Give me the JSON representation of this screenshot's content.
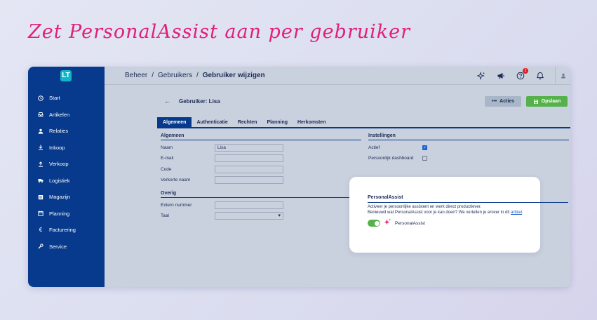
{
  "headline": "Zet PersonalAssist aan per gebruiker",
  "app": {
    "logo": "LT",
    "colors": {
      "sidebar": "#073a8c",
      "accent_green": "#55b24a",
      "headline": "#e0207a"
    }
  },
  "sidebar": {
    "items": [
      {
        "label": "Start",
        "icon": "clock-icon"
      },
      {
        "label": "Artikelen",
        "icon": "inbox-icon"
      },
      {
        "label": "Relaties",
        "icon": "person-icon"
      },
      {
        "label": "Inkoop",
        "icon": "download-icon"
      },
      {
        "label": "Verkoop",
        "icon": "upload-icon"
      },
      {
        "label": "Logistiek",
        "icon": "truck-icon"
      },
      {
        "label": "Magazijn",
        "icon": "warehouse-icon"
      },
      {
        "label": "Planning",
        "icon": "calendar-icon"
      },
      {
        "label": "Facturering",
        "icon": "euro-icon"
      },
      {
        "label": "Service",
        "icon": "wrench-icon"
      }
    ]
  },
  "header": {
    "breadcrumb": [
      "Beheer",
      "Gebruikers",
      "Gebruiker wijzigen"
    ],
    "separator": "/",
    "notification_count": "1"
  },
  "page": {
    "title": "Gebruiker: Lisa",
    "acties_label": "Acties",
    "save_label": "Opslaan"
  },
  "tabs": [
    "Algemeen",
    "Authenticatie",
    "Rechten",
    "Planning",
    "Herkomsten"
  ],
  "algemeen": {
    "title": "Algemeen",
    "fields": [
      {
        "label": "Naam",
        "value": "Lisa"
      },
      {
        "label": "E-mail",
        "value": ""
      },
      {
        "label": "Code",
        "value": ""
      },
      {
        "label": "Verkorte naam",
        "value": ""
      }
    ]
  },
  "overig": {
    "title": "Overig",
    "fields": [
      {
        "label": "Extern nummer",
        "value": ""
      },
      {
        "label": "Taal",
        "value": ""
      }
    ]
  },
  "instellingen": {
    "title": "Instellingen",
    "fields": [
      {
        "label": "Actief",
        "checked": true
      },
      {
        "label": "Persoonlijk dashboard",
        "checked": false
      }
    ]
  },
  "personal_assist": {
    "title": "PersonalAssist",
    "line1": "Activeer je persoonlijke assistent en werk direct productiever.",
    "line2_prefix": "Benieuwd wat PersonalAssist voor je kan doen? We vertellen je erover in dit",
    "link": "artikel",
    "line2_suffix": ".",
    "toggle_label": "PersonalAssist",
    "enabled": true
  }
}
